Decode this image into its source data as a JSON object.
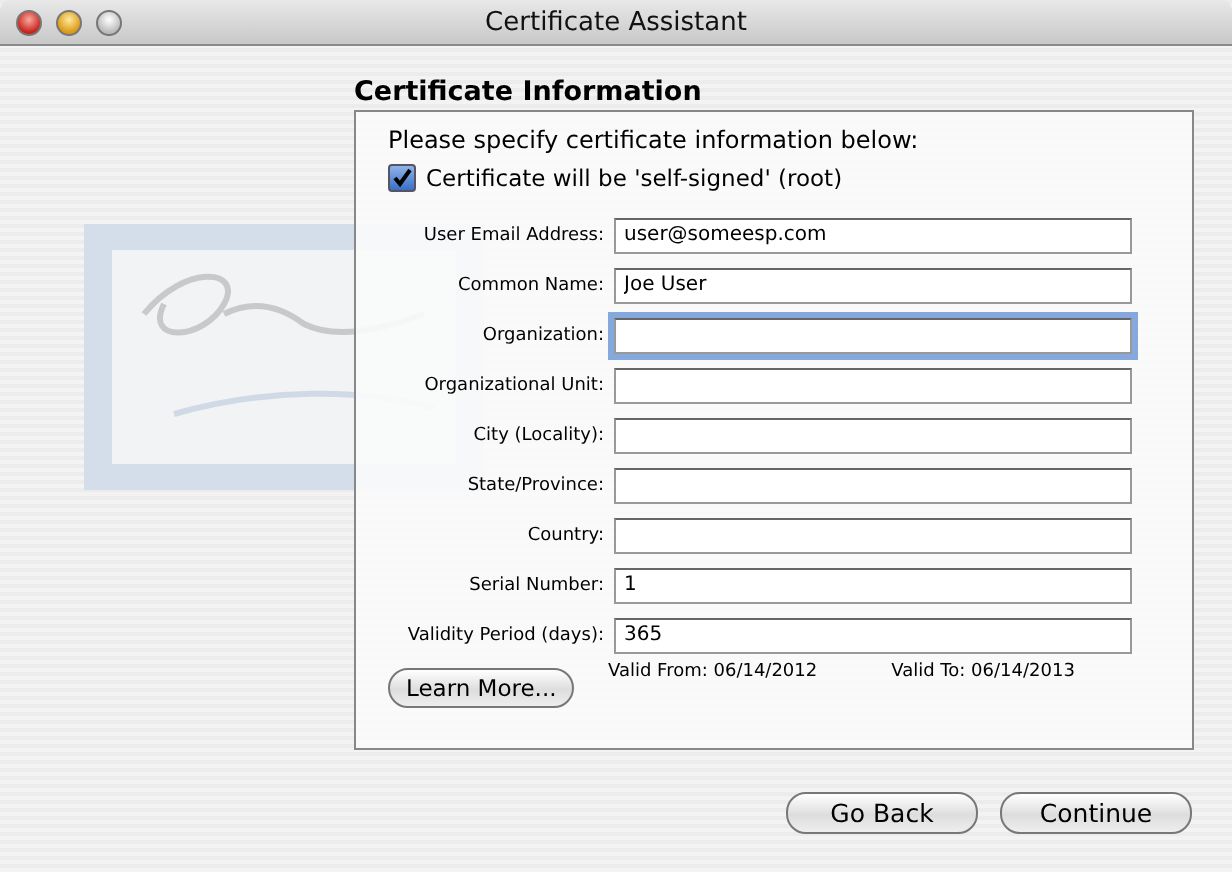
{
  "window": {
    "title": "Certificate Assistant"
  },
  "heading": "Certificate Information",
  "panel": {
    "intro": "Please specify certificate information below:",
    "self_signed": {
      "label": "Certificate will be 'self-signed' (root)",
      "checked": true
    },
    "fields": [
      {
        "label": "User Email Address:",
        "value": "user@someesp.com",
        "focused": false
      },
      {
        "label": "Common Name:",
        "value": "Joe User",
        "focused": false
      },
      {
        "label": "Organization:",
        "focused": true
      },
      {
        "label": "Organizational Unit:",
        "focused": false
      },
      {
        "label": "City (Locality):",
        "focused": false
      },
      {
        "label": "State/Province:",
        "focused": false
      },
      {
        "label": "Country:",
        "focused": false
      },
      {
        "label": "Serial Number:",
        "value": "1",
        "focused": false
      },
      {
        "label": "Validity Period (days):",
        "value": "365",
        "focused": false
      }
    ],
    "valid_from": "Valid From: 06/14/2012",
    "valid_to": "Valid To: 06/14/2013",
    "learn_more": "Learn More..."
  },
  "buttons": [
    "Go Back",
    "Continue"
  ]
}
